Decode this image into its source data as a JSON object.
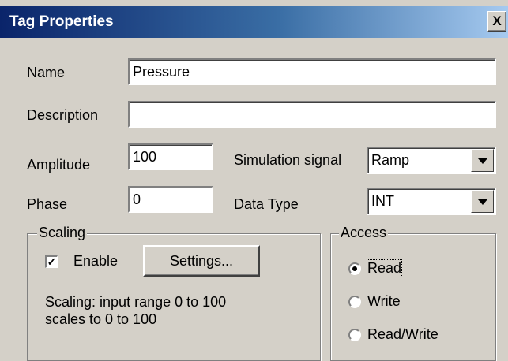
{
  "window": {
    "title": "Tag Properties",
    "close_glyph": "X"
  },
  "labels": {
    "name": "Name",
    "description": "Description",
    "amplitude": "Amplitude",
    "phase": "Phase",
    "simulation_signal": "Simulation signal",
    "data_type": "Data Type"
  },
  "fields": {
    "name": "Pressure",
    "description": "",
    "amplitude": "100",
    "phase": "0"
  },
  "selects": {
    "simulation_signal": "Ramp",
    "data_type": "INT"
  },
  "scaling": {
    "title": "Scaling",
    "enable_label": "Enable",
    "enable_checked": true,
    "check_glyph": "✓",
    "settings_button": "Settings...",
    "info_line1": "Scaling: input range 0 to 100",
    "info_line2": "scales to 0 to 100"
  },
  "access": {
    "title": "Access",
    "options": [
      "Read",
      "Write",
      "Read/Write"
    ],
    "selected": "Read"
  }
}
